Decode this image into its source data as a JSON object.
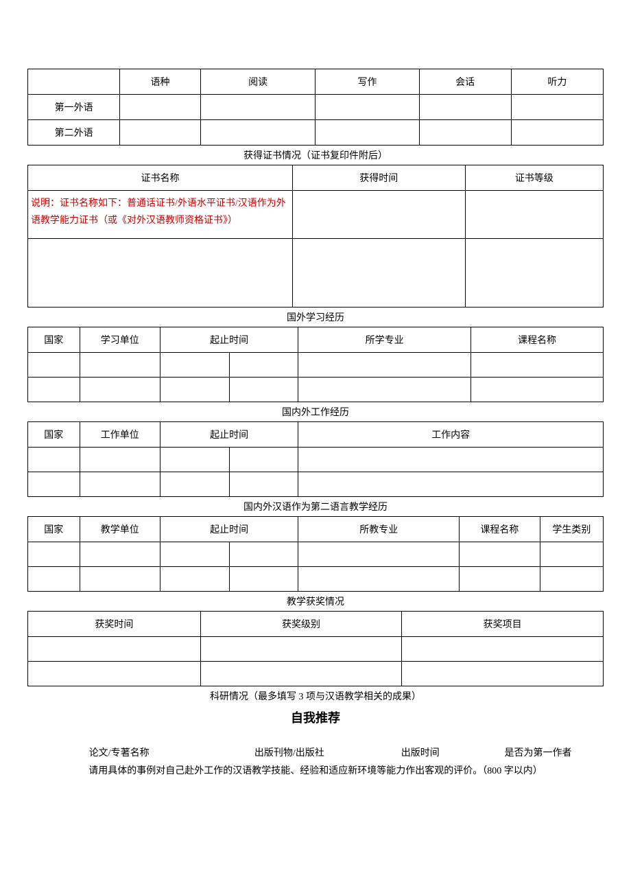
{
  "langTable": {
    "headers": [
      "语种",
      "阅读",
      "写作",
      "会话",
      "听力"
    ],
    "row1Label": "第一外语",
    "row2Label": "第二外语"
  },
  "certSection": {
    "title": "获得证书情况（证书复印件附后）",
    "headers": [
      "证书名称",
      "获得时间",
      "证书等级"
    ],
    "note": "说明：证书名称如下：普通话证书/外语水平证书/汉语作为外语教学能力证书（或《对外汉语教师资格证书》）"
  },
  "studyAbroad": {
    "title": "国外学习经历",
    "headers": [
      "国家",
      "学习单位",
      "起止时间",
      "所学专业",
      "课程名称"
    ]
  },
  "workExp": {
    "title": "国内外工作经历",
    "headers": [
      "国家",
      "工作单位",
      "起止时间",
      "工作内容"
    ]
  },
  "teachExp": {
    "title": "国内外汉语作为第二语言教学经历",
    "headers": [
      "国家",
      "教学单位",
      "起止时间",
      "所教专业",
      "课程名称",
      "学生类别"
    ]
  },
  "awards": {
    "title": "教学获奖情况",
    "headers": [
      "获奖时间",
      "获奖级别",
      "获奖项目"
    ]
  },
  "research": {
    "title": "科研情况（最多填写 3 项与汉语教学相关的成果）",
    "selfRecTitle": "自我推荐",
    "headers": [
      "论文/专著名称",
      "出版刊物/出版社",
      "出版时间",
      "是否为第一作者"
    ],
    "instruction": "请用具体的事例对自己赴外工作的汉语教学技能、经验和适应新环境等能力作出客观的评价。（800 字以内）"
  }
}
